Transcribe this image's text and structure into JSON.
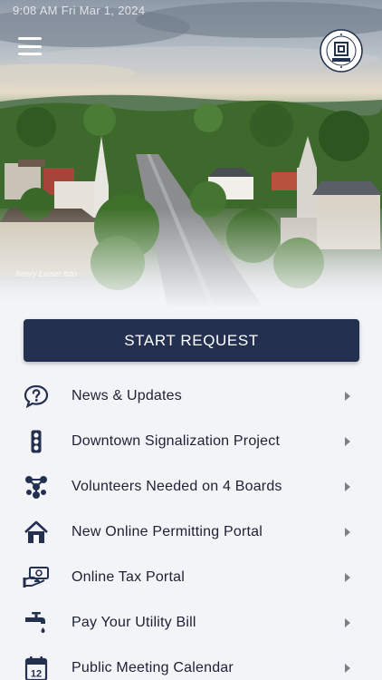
{
  "status_bar": {
    "text": "9:08 AM   Fri Mar 1, 2024"
  },
  "header": {
    "menu_icon": "hamburger-menu-icon",
    "seal": {
      "ring_text": "VILLAGE OF GRANVILLE, OHIO",
      "year_text": "EST 1805",
      "icon": "village-seal-logo"
    },
    "photo_credit": "henry Leiser foto"
  },
  "start_request": {
    "label": "START REQUEST"
  },
  "menu_items": [
    {
      "label": "News & Updates",
      "icon": "question-bubble-icon"
    },
    {
      "label": "Downtown Signalization Project",
      "icon": "traffic-light-icon"
    },
    {
      "label": "Volunteers Needed on 4 Boards",
      "icon": "people-network-icon"
    },
    {
      "label": "New Online Permitting Portal",
      "icon": "house-icon"
    },
    {
      "label": "Online Tax Portal",
      "icon": "money-hand-icon"
    },
    {
      "label": "Pay Your Utility Bill",
      "icon": "water-faucet-icon"
    },
    {
      "label": "Public Meeting Calendar",
      "icon": "calendar-icon"
    }
  ],
  "colors": {
    "primary": "#24304f",
    "background": "#f3f4f7",
    "text": "#1c2233",
    "chevron": "#7a7f8a"
  }
}
